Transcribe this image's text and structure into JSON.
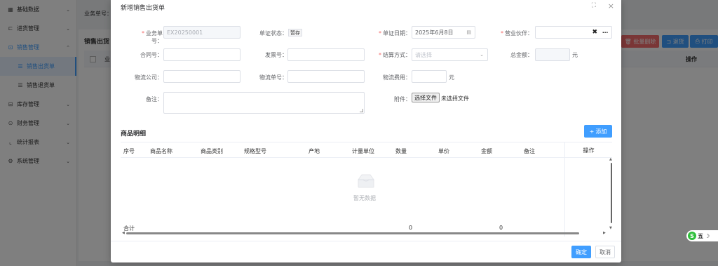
{
  "sidebar": {
    "items": [
      {
        "label": "基础数据",
        "icon": "grid-icon",
        "chevron": "chevron-down"
      },
      {
        "label": "进货管理",
        "icon": "inbound-icon",
        "chevron": "chevron-down"
      },
      {
        "label": "销售管理",
        "icon": "sales-icon",
        "chevron": "chevron-up"
      },
      {
        "label": "销售出货单",
        "icon": "list-icon",
        "selected": true
      },
      {
        "label": "销售退货单",
        "icon": "list-icon"
      },
      {
        "label": "库存管理",
        "icon": "inventory-icon",
        "chevron": "chevron-down"
      },
      {
        "label": "财务管理",
        "icon": "finance-icon",
        "chevron": "chevron-down"
      },
      {
        "label": "统计报表",
        "icon": "chart-icon",
        "chevron": "chevron-down"
      },
      {
        "label": "系统管理",
        "icon": "settings-icon",
        "chevron": "chevron-down"
      }
    ]
  },
  "background": {
    "search_label": "业务单号：",
    "page_title": "销售出货",
    "col_biz": "业",
    "col_op": "操作",
    "btn_batch_delete": "批量删除",
    "btn_return": "退货",
    "btn_print": "打印"
  },
  "dialog": {
    "title": "新增销售出货单",
    "form": {
      "biz_no_label": "业务单号：",
      "biz_no_value": "EX20250001",
      "status_label": "单证状态：",
      "status_value": "暂存",
      "date_label": "单证日期：",
      "date_value": "2025年6月8日",
      "partner_label": "营业伙伴：",
      "partner_value": "",
      "contract_label": "合同号：",
      "contract_value": "",
      "invoice_label": "发票号：",
      "invoice_value": "",
      "settle_label": "结算方式：",
      "settle_placeholder": "请选择",
      "total_label": "总金额：",
      "total_value": "",
      "total_unit": "元",
      "logistics_co_label": "物流公司：",
      "logistics_co_value": "",
      "logistics_no_label": "物流单号：",
      "logistics_no_value": "",
      "logistics_fee_label": "物流费用：",
      "logistics_fee_value": "",
      "logistics_fee_unit": "元",
      "remark_label": "备注：",
      "remark_value": "",
      "attachment_label": "附件：",
      "file_button": "选择文件",
      "file_none": "未选择文件"
    },
    "goods": {
      "title": "商品明细",
      "add_button": "添加",
      "columns": [
        "序号",
        "商品名称",
        "商品类别",
        "规格型号",
        "产地",
        "计量单位",
        "数量",
        "单价",
        "金额",
        "备注",
        "操作"
      ],
      "empty_text": "暂无数据",
      "total_label": "合计",
      "total_qty": "0",
      "total_amount": "0"
    },
    "ok_button": "确定",
    "cancel_button": "取消"
  },
  "ime": {
    "logo": "S",
    "mode": "五"
  },
  "colors": {
    "primary": "#409eff",
    "danger": "#f56c6c",
    "required": "#f56c6c"
  }
}
